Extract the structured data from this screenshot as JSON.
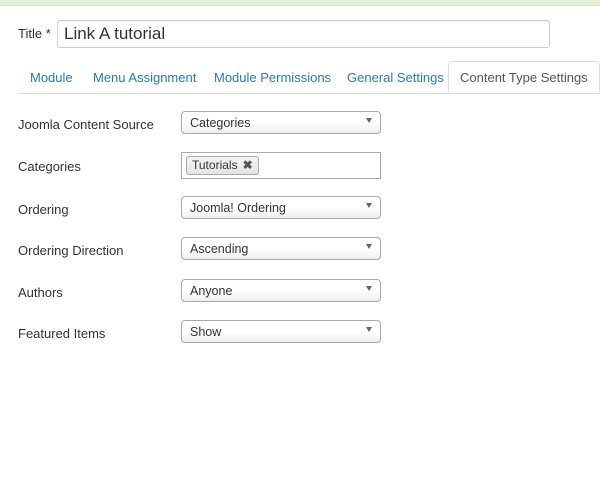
{
  "title": {
    "label": "Title *",
    "value": "Link A tutorial"
  },
  "tabs": [
    {
      "label": "Module",
      "active": false
    },
    {
      "label": "Menu Assignment",
      "active": false
    },
    {
      "label": "Module Permissions",
      "active": false
    },
    {
      "label": "General Settings",
      "active": false
    },
    {
      "label": "Content Type Settings",
      "active": true
    }
  ],
  "fields": {
    "source": {
      "label": "Joomla Content Source",
      "value": "Categories"
    },
    "categories": {
      "label": "Categories",
      "tags": [
        "Tutorials"
      ],
      "remove_icon": "close-icon"
    },
    "ordering": {
      "label": "Ordering",
      "value": "Joomla! Ordering"
    },
    "direction": {
      "label": "Ordering Direction",
      "value": "Ascending"
    },
    "authors": {
      "label": "Authors",
      "value": "Anyone"
    },
    "featured": {
      "label": "Featured Items",
      "value": "Show"
    }
  },
  "colors": {
    "link": "#2a7ab8",
    "success_strip": "#dff0d8"
  }
}
